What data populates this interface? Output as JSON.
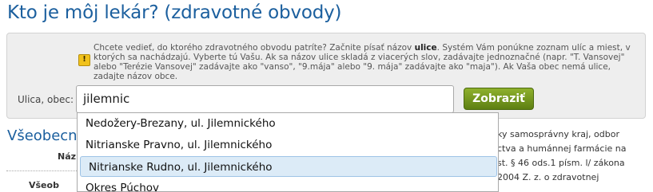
{
  "page": {
    "title": "Kto je môj lekár? (zdravotné obvody)"
  },
  "search": {
    "hint_pre": "Chcete vedieť, do ktorého zdravotného obvodu patríte? Začnite písať názov ",
    "hint_bold": "ulice",
    "hint_post": ". Systém Vám ponúkne zoznam ulíc a miest, v ktorých sa nachádzajú. Vyberte tú Vašu. Ak sa názov ulice skladá z viacerých slov, zadávajte jednoznačné (napr. \"T. Vansovej\" alebo \"Terézie Vansovej\" zadávajte ako \"vanso\", \"9.mája\" alebo \"9. mája\" zadávajte ako \"maja\"). Ak Vaša obec nemá ulice, zadajte názov obce.",
    "label": "Ulica, obec:",
    "value": "jilemnic",
    "button_label": "Zobraziť"
  },
  "section": {
    "heading": "Všeobecný",
    "column_label": "Náz",
    "bottom_label": "Všeob",
    "right_text": [
      "ky samosprávny kraj, odbor",
      "ctva a humánnej farmácie na",
      "st. § 46 ods.1 písm. l/ zákona",
      "2004 Z. z. o zdravotnej"
    ]
  },
  "suggestions": [
    {
      "label": "Nedožery-Brezany, ul. Jilemnického",
      "selected": false
    },
    {
      "label": "Nitrianske Pravno, ul. Jilemnického",
      "selected": false
    },
    {
      "label": "Nitrianske Rudno, ul. Jilemnického",
      "selected": true
    },
    {
      "label": "Okres Púchov",
      "selected": false
    }
  ]
}
